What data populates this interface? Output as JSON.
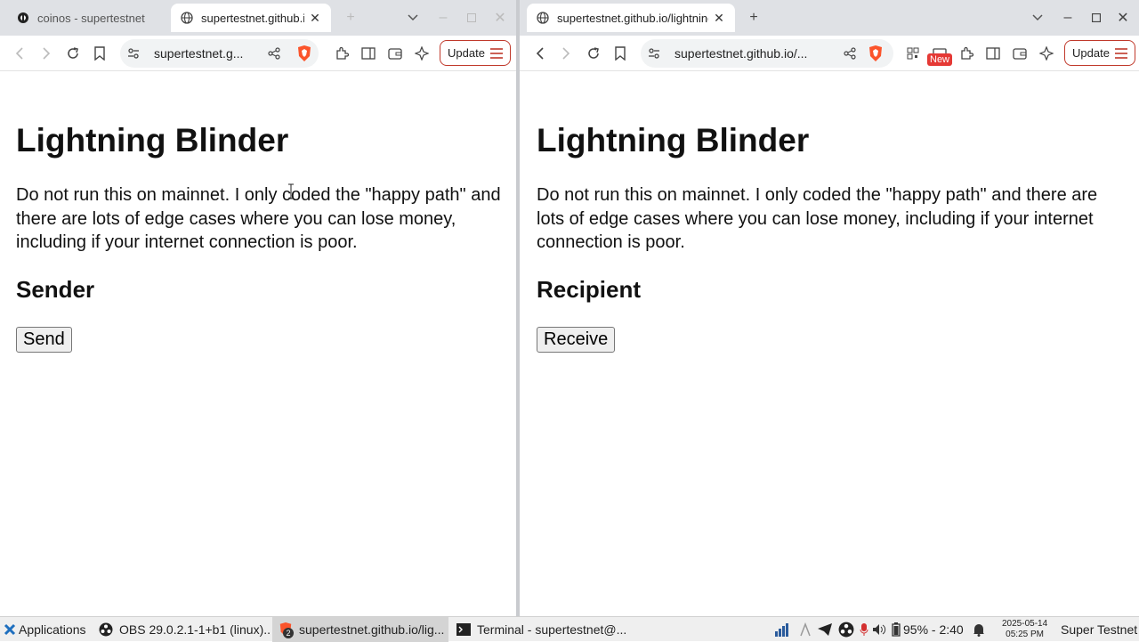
{
  "left_window": {
    "tabs": [
      {
        "title": "coinos - supertestnet",
        "active": false
      },
      {
        "title": "supertestnet.github.io/lightning-blinder",
        "active": true
      }
    ],
    "url": "supertestnet.g...",
    "update_label": "Update",
    "page": {
      "title": "Lightning Blinder",
      "warning": "Do not run this on mainnet. I only coded the \"happy path\" and there are lots of edge cases where you can lose money, including if your internet connection is poor.",
      "section_heading": "Sender",
      "button_label": "Send"
    }
  },
  "right_window": {
    "tabs": [
      {
        "title": "supertestnet.github.io/lightning-blinder",
        "active": true
      }
    ],
    "url": "supertestnet.github.io/...",
    "update_label": "Update",
    "new_badge": "New",
    "page": {
      "title": "Lightning Blinder",
      "warning": "Do not run this on mainnet. I only coded the \"happy path\" and there are lots of edge cases where you can lose money, including if your internet connection is poor.",
      "section_heading": "Recipient",
      "button_label": "Receive"
    }
  },
  "taskbar": {
    "apps_label": "Applications",
    "items": [
      {
        "label": "OBS 29.0.2.1-1+b1 (linux)..."
      },
      {
        "label": "supertestnet.github.io/lig...",
        "badge": "2"
      },
      {
        "label": "Terminal - supertestnet@..."
      }
    ],
    "battery": "95% - 2:40",
    "date": "2025-05-14",
    "time": "05:25 PM",
    "user": "Super Testnet"
  },
  "colors": {
    "tabbar": "#dfe1e5",
    "update_border": "#c0392b",
    "brave_orange": "#fb542b",
    "new_badge": "#e53935"
  }
}
